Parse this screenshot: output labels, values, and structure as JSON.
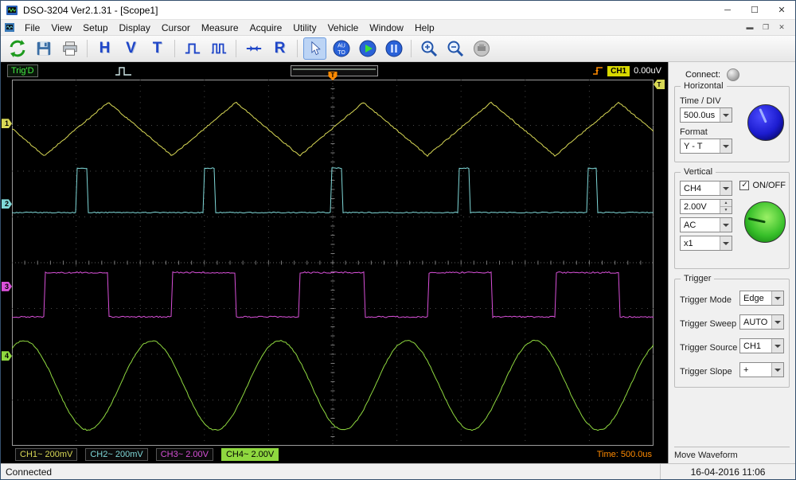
{
  "window": {
    "title": "DSO-3204 Ver2.1.31 - [Scope1]"
  },
  "menu": {
    "items": [
      "File",
      "View",
      "Setup",
      "Display",
      "Cursor",
      "Measure",
      "Acquire",
      "Utility",
      "Vehicle",
      "Window",
      "Help"
    ]
  },
  "toolbar": {
    "h": "H",
    "v": "V",
    "t": "T",
    "r": "R",
    "auto_top": "AU",
    "auto_bottom": "TO"
  },
  "trig_bar": {
    "status": "Trig'D",
    "source": "CH1",
    "level": "0.00uV"
  },
  "scope": {
    "trigger_marker": "T",
    "time_label": "Time: 500.0us",
    "channels": [
      {
        "num": "1",
        "label": "CH1~",
        "scale": "200mV",
        "color": "#d8d855",
        "flag_top": 0.12,
        "selected": false
      },
      {
        "num": "2",
        "label": "CH2~",
        "scale": "200mV",
        "color": "#7fd8d8",
        "flag_top": 0.34,
        "selected": false
      },
      {
        "num": "3",
        "label": "CH3~",
        "scale": "2.00V",
        "color": "#d850d8",
        "flag_top": 0.565,
        "selected": false
      },
      {
        "num": "4",
        "label": "CH4~",
        "scale": "2.00V",
        "color": "#8fd83f",
        "flag_top": 0.755,
        "selected": true
      }
    ],
    "waveforms": [
      {
        "name": "CH1",
        "type": "triangle",
        "color": "#d8d855",
        "period": 0.199,
        "shift": 0.15,
        "center": 0.135,
        "amp": 0.073,
        "noise": 1.6
      },
      {
        "name": "CH2",
        "type": "pulse",
        "color": "#7fd8d8",
        "period": 0.199,
        "shift": 0.1,
        "base": 0.363,
        "top": 0.242,
        "duty": 0.085,
        "noise": 1.2
      },
      {
        "name": "CH3",
        "type": "square",
        "color": "#d850d8",
        "period": 0.199,
        "shift": 0.051,
        "low": 0.648,
        "high": 0.527,
        "duty": 0.5,
        "noise": 1.8
      },
      {
        "name": "CH4",
        "type": "sine",
        "color": "#8fd83f",
        "period": 0.199,
        "shift": 0.218,
        "center": 0.835,
        "amp": 0.122,
        "noise": 1.6
      }
    ]
  },
  "panel": {
    "connect_label": "Connect:",
    "horizontal": {
      "title": "Horizontal",
      "time_div_label": "Time / DIV",
      "time_div_value": "500.0us",
      "format_label": "Format",
      "format_value": "Y - T"
    },
    "vertical": {
      "title": "Vertical",
      "channel_value": "CH4",
      "onoff_label": "ON/OFF",
      "onoff_checked": "✓",
      "scale_value": "2.00V",
      "coupling_value": "AC",
      "probe_value": "x1"
    },
    "trigger": {
      "title": "Trigger",
      "rows": [
        {
          "label": "Trigger Mode",
          "value": "Edge"
        },
        {
          "label": "Trigger Sweep",
          "value": "AUTO"
        },
        {
          "label": "Trigger Source",
          "value": "CH1"
        },
        {
          "label": "Trigger Slope",
          "value": "+"
        }
      ]
    },
    "move_waveform": "Move Waveform"
  },
  "statusbar": {
    "left": "Connected",
    "datetime": "16-04-2016 11:06"
  }
}
